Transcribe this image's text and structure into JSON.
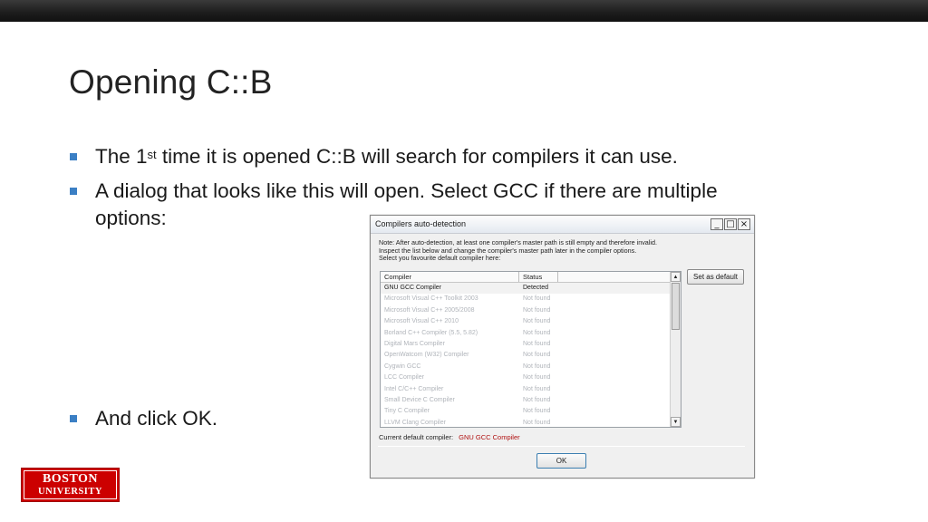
{
  "slide": {
    "title": "Opening C::B",
    "bullet_color": "#3b7fc4",
    "bullets": [
      {
        "pre": "The 1",
        "sup": "st",
        "post": " time it is opened C::B will search for compilers it can use."
      },
      {
        "line1": "A dialog that looks like this will open. Select GCC if there are multiple",
        "line2": "options:"
      },
      {
        "text": "And click OK."
      }
    ]
  },
  "dialog": {
    "title": "Compilers auto-detection",
    "controls": {
      "minimize": "_",
      "maximize": "□",
      "close": "×"
    },
    "note_lines": [
      "Note: After auto-detection, at least one compiler's master path is still empty and therefore invalid.",
      "Inspect the list below and change the compiler's master path later in the compiler options.",
      "Select you favourite default compiler here:"
    ],
    "columns": [
      "Compiler",
      "Status"
    ],
    "rows": [
      {
        "compiler": "GNU GCC Compiler",
        "status": "Detected"
      },
      {
        "compiler": "Microsoft Visual C++ Toolkit 2003",
        "status": "Not found"
      },
      {
        "compiler": "Microsoft Visual C++ 2005/2008",
        "status": "Not found"
      },
      {
        "compiler": "Microsoft Visual C++ 2010",
        "status": "Not found"
      },
      {
        "compiler": "Borland C++ Compiler (5.5, 5.82)",
        "status": "Not found"
      },
      {
        "compiler": "Digital Mars Compiler",
        "status": "Not found"
      },
      {
        "compiler": "OpenWatcom (W32) Compiler",
        "status": "Not found"
      },
      {
        "compiler": "Cygwin GCC",
        "status": "Not found"
      },
      {
        "compiler": "LCC Compiler",
        "status": "Not found"
      },
      {
        "compiler": "Intel C/C++ Compiler",
        "status": "Not found"
      },
      {
        "compiler": "Small Device C Compiler",
        "status": "Not found"
      },
      {
        "compiler": "Tiny C Compiler",
        "status": "Not found"
      },
      {
        "compiler": "LLVM Clang Compiler",
        "status": "Not found"
      }
    ],
    "scroll_up": "▲",
    "scroll_down": "▼",
    "set_default_label": "Set as default",
    "current_default_label": "Current default compiler:",
    "current_default_value": "GNU GCC Compiler",
    "ok_label": "OK"
  },
  "logo": {
    "line1": "BOSTON",
    "line2": "UNIVERSITY"
  }
}
